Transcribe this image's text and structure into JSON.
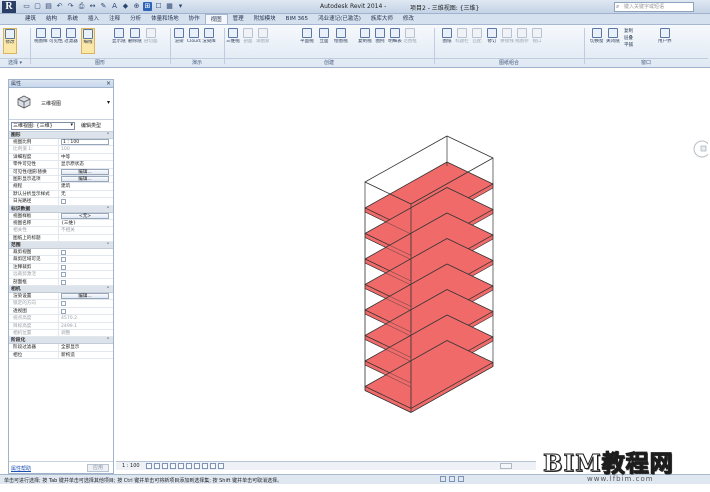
{
  "app": {
    "logo_letter": "R",
    "title": "Autodesk Revit 2014 -",
    "document": "项目2 - 三维视图: {三维}",
    "search_placeholder": "键入关键字或短语"
  },
  "quick_access": [
    "▭",
    "▢",
    "▤",
    "↶",
    "↷",
    "⎙",
    "↔",
    "✎",
    "A",
    "◆",
    "⊕",
    "⊞",
    "☐",
    "▦",
    "▾"
  ],
  "tabs": [
    {
      "label": "建筑"
    },
    {
      "label": "结构"
    },
    {
      "label": "系统"
    },
    {
      "label": "插入"
    },
    {
      "label": "注释"
    },
    {
      "label": "分析"
    },
    {
      "label": "体量和场地"
    },
    {
      "label": "协作"
    },
    {
      "label": "视图",
      "active": true
    },
    {
      "label": "管理"
    },
    {
      "label": "附加模块"
    },
    {
      "label": "BIM 365"
    },
    {
      "label": "鸿业速记(已激活)"
    },
    {
      "label": "族库大师"
    },
    {
      "label": "修改"
    }
  ],
  "ribbon": {
    "buttons": [
      {
        "label": "修改",
        "selected": true
      },
      {
        "label": "视图样板"
      },
      {
        "label": "可见性/图形"
      },
      {
        "label": "过滤器"
      },
      {
        "label": "细线",
        "selected": true
      },
      {
        "label": "显示隐藏线"
      },
      {
        "label": "删除隐藏线"
      },
      {
        "label": "剖切面轮廓",
        "disabled": true
      },
      {
        "label": "渲染"
      },
      {
        "label": "Cloud渲染"
      },
      {
        "label": "渲染库"
      },
      {
        "label": "三维视图"
      },
      {
        "label": "剖面",
        "disabled": true
      },
      {
        "label": "详图索引",
        "disabled": true
      },
      {
        "label": "平面视图"
      },
      {
        "label": "立面"
      },
      {
        "label": "绘图视图"
      },
      {
        "label": "复制视图"
      },
      {
        "label": "图例"
      },
      {
        "label": "明细表"
      },
      {
        "label": "范围框",
        "disabled": true
      },
      {
        "label": "图纸"
      },
      {
        "label": "标题栏",
        "disabled": true
      },
      {
        "label": "匹配",
        "disabled": true
      },
      {
        "label": "修订"
      },
      {
        "label": "拼接线",
        "disabled": true
      },
      {
        "label": "视图参照",
        "disabled": true
      },
      {
        "label": "视口",
        "disabled": true
      },
      {
        "label": "切换窗口"
      },
      {
        "label": "关闭隐藏对象"
      },
      {
        "label": "用户界面"
      }
    ],
    "small_buttons": [
      "复制",
      "层叠",
      "平铺"
    ],
    "panels": [
      "选择 ▾",
      "图形",
      "演示",
      "创建",
      "图纸组合",
      "窗口"
    ]
  },
  "properties": {
    "title": "属性",
    "close": "×",
    "type_name": "三维视图",
    "instance_selector": "三维视图: {三维}",
    "edit_type": "编辑类型",
    "groups": [
      {
        "title": "图形",
        "rows": [
          {
            "key": "视图比例",
            "value": "1 : 100",
            "field": true
          },
          {
            "key": "比例值 1:",
            "value": "100",
            "dim": true
          },
          {
            "key": "详细程度",
            "value": "中等"
          },
          {
            "key": "零件可见性",
            "value": "显示原状态"
          },
          {
            "key": "可见性/图形替换",
            "value": "编辑...",
            "button": true
          },
          {
            "key": "图形显示选项",
            "value": "编辑...",
            "button": true
          },
          {
            "key": "规程",
            "value": "建筑"
          },
          {
            "key": "默认分析显示样式",
            "value": "无"
          },
          {
            "key": "日光路径",
            "checkbox": true
          }
        ]
      },
      {
        "title": "标识数据",
        "rows": [
          {
            "key": "视图样板",
            "value": "<无>",
            "button": true
          },
          {
            "key": "视图名称",
            "value": "{三维}"
          },
          {
            "key": "相关性",
            "value": "不相关",
            "dim": true
          },
          {
            "key": "图纸上的标题",
            "value": ""
          }
        ]
      },
      {
        "title": "范围",
        "rows": [
          {
            "key": "裁剪视图",
            "checkbox": true
          },
          {
            "key": "裁剪区域可见",
            "checkbox": true
          },
          {
            "key": "注释裁剪",
            "checkbox": true
          },
          {
            "key": "远裁剪激活",
            "checkbox": true,
            "dim": true
          },
          {
            "key": "剖面框",
            "checkbox": true
          }
        ]
      },
      {
        "title": "相机",
        "rows": [
          {
            "key": "渲染设置",
            "value": "编辑...",
            "button": true
          },
          {
            "key": "锁定的方向",
            "checkbox": true,
            "dim": true
          },
          {
            "key": "透视图",
            "checkbox": true
          },
          {
            "key": "视点高度",
            "value": "4570.2",
            "dim": true
          },
          {
            "key": "目标高度",
            "value": "2499.1",
            "dim": true
          },
          {
            "key": "相机位置",
            "value": "调整",
            "dim": true
          }
        ]
      },
      {
        "title": "阶段化",
        "rows": [
          {
            "key": "阶段过滤器",
            "value": "全部显示"
          },
          {
            "key": "相位",
            "value": "新构造"
          }
        ]
      }
    ],
    "help_link": "属性帮助",
    "apply": "应用"
  },
  "view_bar": {
    "scale": "1 : 100"
  },
  "status": {
    "text": "单击可进行选择; 按 Tab 键并单击可选择其他项目; 按 Ctrl 键并单击可将新项目添加到选择集; 按 Shift 键并单击可取消选择。"
  },
  "watermark": {
    "title": "BIM教程网",
    "url": "www.lfbim.com"
  },
  "colors": {
    "slab_fill": "#f06a6a",
    "slab_stroke": "#333333",
    "accent": "#2e63b8"
  }
}
